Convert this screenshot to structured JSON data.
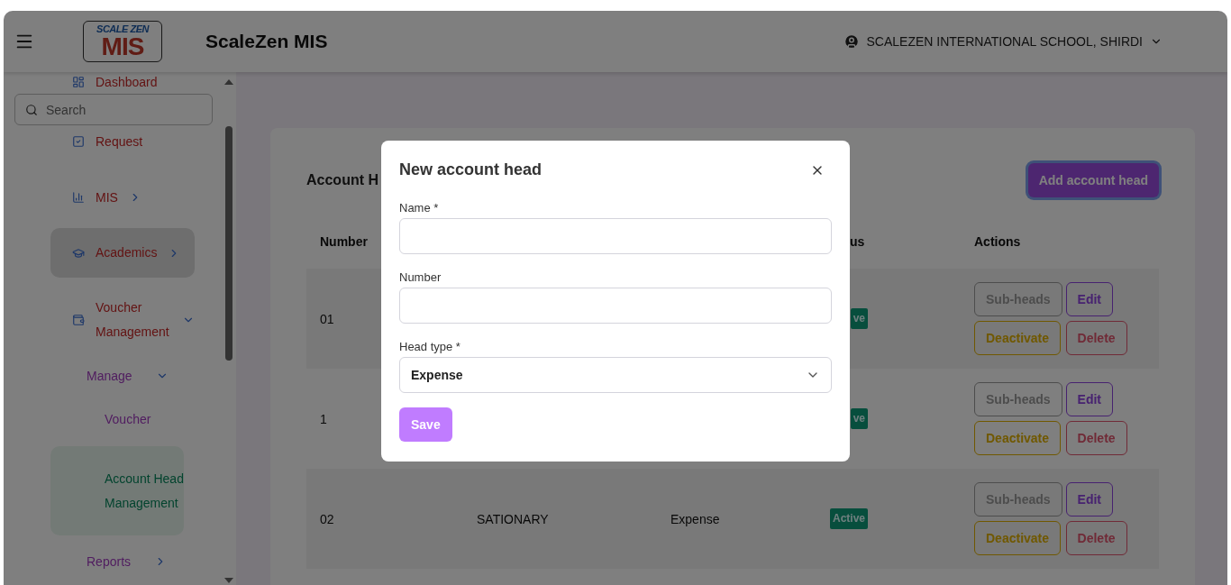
{
  "header": {
    "logo": {
      "line_1": "SCALE ZEN",
      "line_2": "MIS"
    },
    "app_title": "ScaleZen MIS",
    "school": "SCALEZEN INTERNATIONAL SCHOOL, SHIRDI"
  },
  "sidebar": {
    "search": {
      "placeholder": "Search"
    },
    "items": [
      {
        "label": "Dashboard",
        "kind": "link"
      },
      {
        "label": "Request",
        "kind": "link"
      },
      {
        "label": "MIS",
        "kind": "group",
        "expanded": false,
        "hovered": false
      },
      {
        "label": "Academics",
        "kind": "group",
        "expanded": false,
        "hovered": true
      },
      {
        "label": "Voucher Management",
        "kind": "group",
        "expanded": true,
        "hovered": false,
        "children": [
          {
            "label": "Manage",
            "expanded": true,
            "children": [
              {
                "label": "Voucher",
                "selected": false
              },
              {
                "label": "Account Head Management",
                "selected": true
              }
            ]
          },
          {
            "label": "Reports",
            "expanded": false
          }
        ]
      }
    ]
  },
  "page": {
    "heading": "Account H",
    "add_button": "Add account head",
    "table": {
      "columns": [
        "Number",
        "us",
        "Actions"
      ],
      "rows": [
        {
          "number": "01",
          "status": "ve",
          "actions": [
            {
              "label": "Sub-heads",
              "kind": "neutral"
            },
            {
              "label": "Edit",
              "kind": "primary"
            },
            {
              "label": "Deactivate",
              "kind": "warning"
            },
            {
              "label": "Delete",
              "kind": "danger"
            }
          ]
        },
        {
          "number": "1",
          "status": "ve",
          "actions": [
            {
              "label": "Sub-heads",
              "kind": "neutral"
            },
            {
              "label": "Edit",
              "kind": "primary"
            },
            {
              "label": "Deactivate",
              "kind": "warning"
            },
            {
              "label": "Delete",
              "kind": "danger"
            }
          ]
        },
        {
          "number": "02",
          "name": "SATIONARY",
          "type": "Expense",
          "status": "Active",
          "actions": [
            {
              "label": "Sub-heads",
              "kind": "neutral"
            },
            {
              "label": "Edit",
              "kind": "primary"
            },
            {
              "label": "Deactivate",
              "kind": "warning"
            },
            {
              "label": "Delete",
              "kind": "danger"
            }
          ]
        }
      ]
    }
  },
  "modal": {
    "title": "New account head",
    "fields": [
      {
        "label": "Name *",
        "kind": "text"
      },
      {
        "label": "Number",
        "kind": "text"
      },
      {
        "label": "Head type *",
        "kind": "select",
        "value": "Expense"
      }
    ],
    "save": "Save"
  }
}
